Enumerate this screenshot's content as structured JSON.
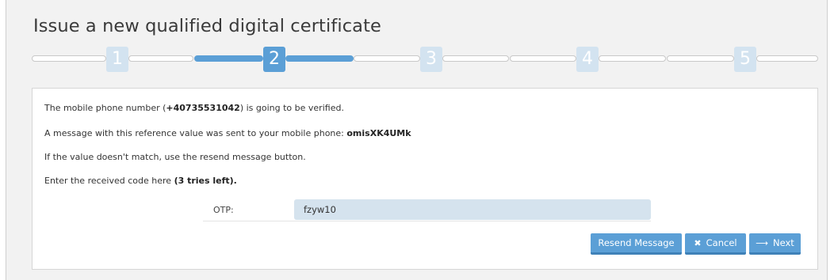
{
  "page": {
    "title": "Issue a new qualified digital certificate"
  },
  "stepper": {
    "steps": [
      "1",
      "2",
      "3",
      "4",
      "5"
    ],
    "active_step": 2
  },
  "panel": {
    "line1": {
      "prefix": "The mobile phone number (",
      "phone": "+40735531042",
      "suffix": ") is going to be verified."
    },
    "line2": {
      "prefix": "A message with this reference value was sent to your mobile phone: ",
      "reference": "omisXK4UMk"
    },
    "line3": "If the value doesn't match, use the resend message button.",
    "line4": {
      "prefix": "Enter the received code here ",
      "tries": "(3 tries left)."
    },
    "otp": {
      "label": "OTP:",
      "value": "fzyw10"
    }
  },
  "buttons": {
    "resend": "Resend Message",
    "cancel": "Cancel",
    "cancel_icon": "close-x-icon",
    "next": "Next",
    "next_icon": "arrow-right-icon"
  },
  "colors": {
    "accent": "#5b9fd6",
    "accent_dark": "#3f81b8",
    "inactive_step": "#d3e3f0",
    "input_bg": "#d5e3ee"
  }
}
